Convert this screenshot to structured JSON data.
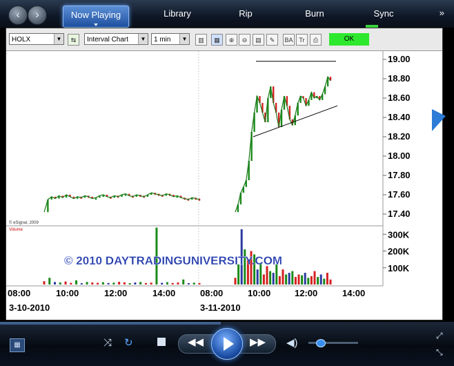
{
  "player": {
    "tabs": [
      {
        "label": "Now Playing",
        "active": true
      },
      {
        "label": "Library"
      },
      {
        "label": "Rip"
      },
      {
        "label": "Burn"
      },
      {
        "label": "Sync"
      }
    ],
    "more_label": "»",
    "back_icon": "back-arrow-icon",
    "forward_icon": "forward-arrow-icon"
  },
  "toolbar": {
    "symbol": "HOLX",
    "chart_type": "Interval Chart",
    "interval": "1 min",
    "ok_label": "OK",
    "icons": [
      "bar-chart-icon",
      "zoom-in-icon",
      "zoom-out-icon",
      "grid-icon",
      "palette-icon",
      "ba-icon",
      "tr-icon",
      "print-icon"
    ],
    "ba_label": "BA",
    "tr_label": "Tr"
  },
  "chart_data": {
    "type": "line",
    "price_ticks": [
      "19.00",
      "18.80",
      "18.60",
      "18.40",
      "18.20",
      "18.00",
      "17.80",
      "17.60",
      "17.40"
    ],
    "volume_ticks": [
      "300K",
      "200K",
      "100K"
    ],
    "time_ticks": [
      "08:00",
      "10:00",
      "12:00",
      "14:00",
      "08:00",
      "10:00",
      "12:00",
      "14:00"
    ],
    "date_labels": [
      "3-10-2010",
      "3-11-2010"
    ],
    "copyright": "© eSignal, 2009",
    "volume_label": "Volume",
    "watermark": "© 2010 DAYTRADINGUNIVERSITY.COM",
    "ylim": [
      17.3,
      19.05
    ],
    "volume_max": 330000,
    "day1_price": [
      17.42,
      17.55,
      17.58,
      17.56,
      17.59,
      17.57,
      17.6,
      17.58,
      17.56,
      17.58,
      17.57,
      17.59,
      17.58,
      17.56,
      17.57,
      17.59,
      17.6,
      17.58,
      17.57,
      17.59,
      17.58,
      17.6,
      17.61,
      17.59,
      17.58,
      17.6,
      17.59,
      17.58,
      17.6,
      17.62,
      17.61,
      17.6,
      17.59,
      17.61,
      17.6,
      17.58,
      17.59,
      17.57,
      17.56,
      17.55,
      17.57,
      17.56,
      17.55
    ],
    "day2_price": [
      17.42,
      17.5,
      17.62,
      17.68,
      17.75,
      17.95,
      18.25,
      18.45,
      18.62,
      18.55,
      18.45,
      18.35,
      18.6,
      18.72,
      18.55,
      18.45,
      18.3,
      18.48,
      18.62,
      18.52,
      18.38,
      18.32,
      18.42,
      18.55,
      18.62,
      18.6,
      18.52,
      18.58,
      18.66,
      18.6,
      18.62,
      18.58,
      18.64,
      18.72,
      18.82,
      18.78
    ],
    "day1_volume": [
      20000,
      40000,
      15000,
      12000,
      18000,
      10000,
      25000,
      8000,
      15000,
      12000,
      10000,
      14000,
      9000,
      11000,
      16000,
      13000,
      8000,
      12000,
      15000,
      9000,
      11000,
      340000,
      10000,
      14000,
      9000,
      12000,
      30000,
      8000,
      11000,
      9000
    ],
    "day2_volume": [
      40000,
      120000,
      330000,
      210000,
      150000,
      200000,
      180000,
      90000,
      130000,
      60000,
      110000,
      80000,
      70000,
      120000,
      50000,
      90000,
      60000,
      70000,
      80000,
      45000,
      60000,
      55000,
      70000,
      40000,
      50000,
      80000,
      45000,
      60000,
      35000,
      70000,
      30000
    ],
    "annotations": {
      "resistance_level": 18.98,
      "support_start": 18.2,
      "support_end": 18.52
    }
  }
}
